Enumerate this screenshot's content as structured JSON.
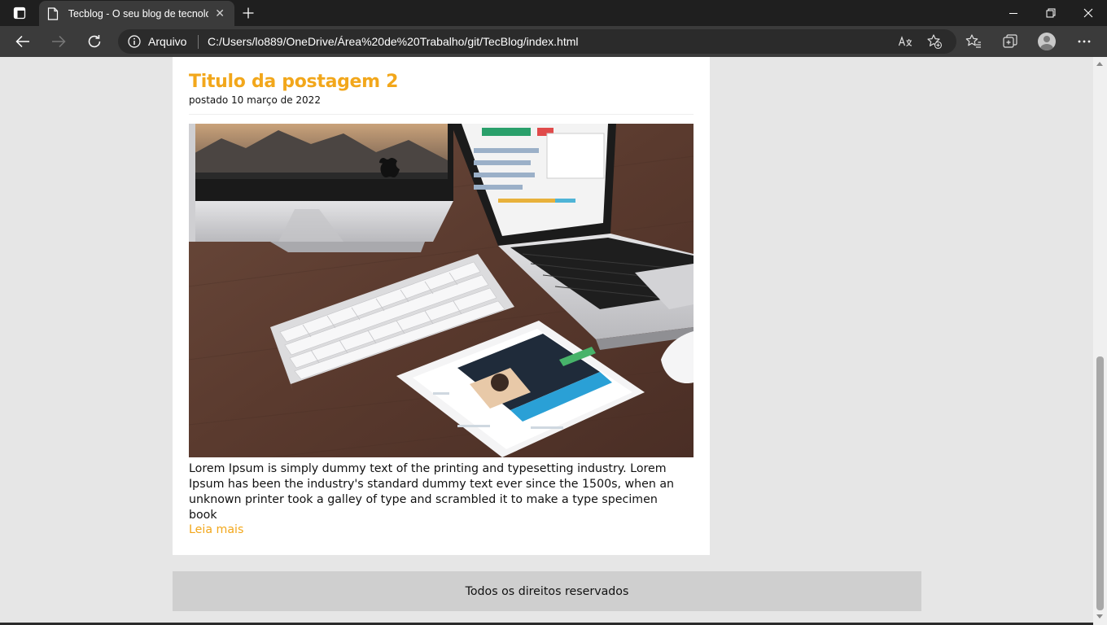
{
  "browser": {
    "tab_title": "Tecblog - O seu blog de tecnologia",
    "tab_close": "✕",
    "new_tab": "+",
    "site_info_label": "Arquivo",
    "url": "C:/Users/lo889/OneDrive/Área%20de%20Trabalho/git/TecBlog/index.html"
  },
  "post": {
    "title": "Titulo da postagem 2",
    "date": "postado 10 março de 2022",
    "image_alt": "Mesa com iMac, MacBook, teclado, iPad e mouse",
    "excerpt": "Lorem Ipsum is simply dummy text of the printing and typesetting industry. Lorem Ipsum has been the industry's standard dummy text ever since the 1500s, when an unknown printer took a galley of type and scrambled it to make a type specimen book",
    "read_more": "Leia mais"
  },
  "footer": {
    "text": "Todos os direitos reservados"
  },
  "colors": {
    "accent": "#f2a71b",
    "page_bg": "#e6e6e6",
    "card_bg": "#ffffff",
    "footer_bg": "#cfcfcf",
    "chrome_dark": "#1f1f1f",
    "chrome_toolbar": "#3b3b3b"
  }
}
